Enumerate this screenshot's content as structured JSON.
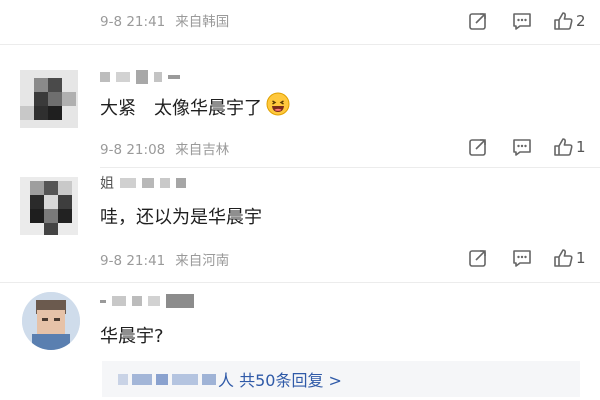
{
  "comments": [
    {
      "meta": {
        "time": "9-8 21:41",
        "location": "来自韩国"
      },
      "actions": {
        "likes": "2"
      }
    },
    {
      "text": "大紧　太像华晨宇了",
      "emoji": "laughing-face",
      "meta": {
        "time": "9-8 21:08",
        "location": "来自吉林"
      },
      "actions": {
        "likes": "1"
      }
    },
    {
      "name_partial": "姐",
      "text": "哇，还以为是华晨宇",
      "meta": {
        "time": "9-8 21:41",
        "location": "来自河南"
      },
      "actions": {
        "likes": "1"
      }
    },
    {
      "text": "华晨宇?"
    }
  ],
  "replies": {
    "suffix": "人 共50条回复 >"
  },
  "colors": {
    "meta": "#9a9a9a",
    "link": "#3b5ea3",
    "divider": "#ececec"
  }
}
